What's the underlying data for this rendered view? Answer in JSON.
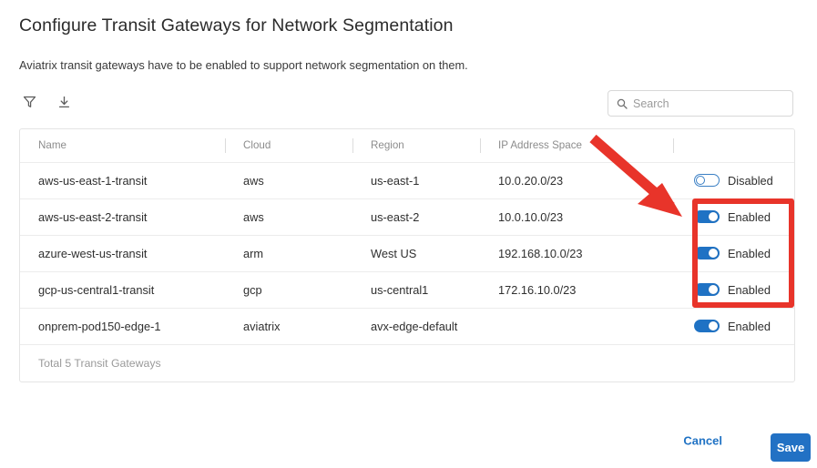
{
  "page": {
    "title": "Configure Transit Gateways for Network Segmentation",
    "subtitle": "Aviatrix transit gateways have to be enabled to support network segmentation on them."
  },
  "toolbar": {
    "filter_icon": "filter-icon",
    "download_icon": "download-icon"
  },
  "search": {
    "placeholder": "Search",
    "value": "",
    "icon": "search-icon"
  },
  "table": {
    "columns": [
      "Name",
      "Cloud",
      "Region",
      "IP Address Space",
      ""
    ],
    "rows": [
      {
        "name": "aws-us-east-1-transit",
        "cloud": "aws",
        "region": "us-east-1",
        "ip_address_space": "10.0.20.0/23",
        "state_label": "Disabled",
        "enabled": false
      },
      {
        "name": "aws-us-east-2-transit",
        "cloud": "aws",
        "region": "us-east-2",
        "ip_address_space": "10.0.10.0/23",
        "state_label": "Enabled",
        "enabled": true
      },
      {
        "name": "azure-west-us-transit",
        "cloud": "arm",
        "region": "West US",
        "ip_address_space": "192.168.10.0/23",
        "state_label": "Enabled",
        "enabled": true
      },
      {
        "name": "gcp-us-central1-transit",
        "cloud": "gcp",
        "region": "us-central1",
        "ip_address_space": "172.16.10.0/23",
        "state_label": "Enabled",
        "enabled": true
      },
      {
        "name": "onprem-pod150-edge-1",
        "cloud": "aviatrix",
        "region": "avx-edge-default",
        "ip_address_space": "",
        "state_label": "Enabled",
        "enabled": true
      }
    ],
    "footer_text": "Total 5 Transit Gateways"
  },
  "footer": {
    "cancel_label": "Cancel",
    "save_label": "Save"
  },
  "annotations": {
    "arrow": "red-arrow",
    "highlight": "red-highlight-box"
  },
  "colors": {
    "accent_blue": "#1f72c4",
    "save_blue": "#2271c4",
    "annotation_red": "#e8342a",
    "muted_text": "#9a9a9a",
    "border": "#ececec"
  }
}
